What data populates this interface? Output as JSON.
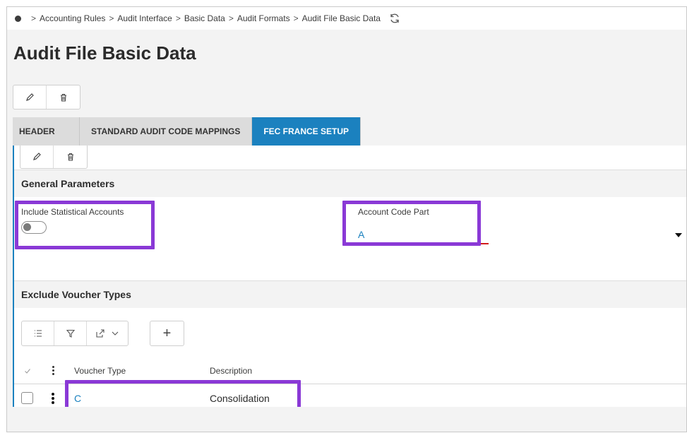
{
  "breadcrumb": {
    "items": [
      "Accounting Rules",
      "Audit Interface",
      "Basic Data",
      "Audit Formats",
      "Audit File Basic Data"
    ],
    "separator": ">",
    "prefix_separator": ">"
  },
  "page": {
    "title": "Audit File Basic Data"
  },
  "tabs": [
    {
      "label": "HEADER",
      "active": false
    },
    {
      "label": "STANDARD AUDIT CODE MAPPINGS",
      "active": false
    },
    {
      "label": "FEC FRANCE SETUP",
      "active": true
    }
  ],
  "general_parameters": {
    "title": "General Parameters",
    "include_statistical_accounts": {
      "label": "Include Statistical Accounts",
      "value": false
    },
    "account_code_part": {
      "label": "Account Code Part",
      "value": "A"
    }
  },
  "exclude_voucher_types": {
    "title": "Exclude Voucher Types",
    "add_label": "+",
    "columns": {
      "voucher_type": "Voucher Type",
      "description": "Description"
    },
    "rows": [
      {
        "voucher_type": "C",
        "description": "Consolidation",
        "checked": false
      }
    ]
  },
  "colors": {
    "accent": "#1b81bf",
    "highlight": "#8a39d6",
    "error_line": "#d21a1a"
  },
  "icons": [
    "status-dot-icon",
    "refresh-icon",
    "pencil-icon",
    "trash-icon",
    "list-settings-icon",
    "filter-icon",
    "export-icon",
    "chevron-down-icon",
    "plus-icon",
    "check-icon",
    "kebab-icon",
    "dropdown-caret-icon"
  ]
}
